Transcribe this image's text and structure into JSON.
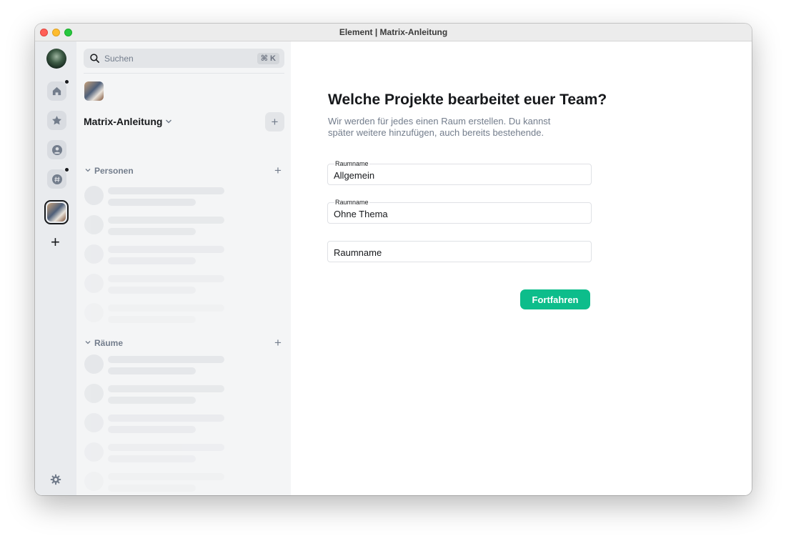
{
  "window": {
    "title": "Element | Matrix-Anleitung"
  },
  "spacebar": {
    "items": [
      {
        "icon": "home-icon",
        "unread": true
      },
      {
        "icon": "star-icon",
        "unread": false
      },
      {
        "icon": "person-icon",
        "unread": false
      },
      {
        "icon": "hash-icon",
        "unread": true
      }
    ],
    "add_label": "+"
  },
  "roomlist": {
    "search_placeholder": "Suchen",
    "search_shortcut": "⌘ K",
    "space_name": "Matrix-Anleitung",
    "space_add": "+",
    "sections": [
      {
        "label": "Personen",
        "add": "+"
      },
      {
        "label": "Räume",
        "add": "+"
      }
    ]
  },
  "main": {
    "heading": "Welche Projekte bearbeitet euer Team?",
    "subtitle": "Wir werden für jedes einen Raum erstellen. Du kannst später weitere hinzufügen, auch bereits bestehende.",
    "fields": [
      {
        "label": "Raumname",
        "value": "Allgemein",
        "placeholder": ""
      },
      {
        "label": "Raumname",
        "value": "Ohne Thema",
        "placeholder": ""
      },
      {
        "label": "",
        "value": "",
        "placeholder": "Raumname"
      }
    ],
    "continue_label": "Fortfahren"
  },
  "colors": {
    "accent": "#0dbd8b",
    "sidebar_bg": "#e9ebee",
    "roomlist_bg": "#f4f5f6",
    "text_muted": "#737d8c"
  }
}
